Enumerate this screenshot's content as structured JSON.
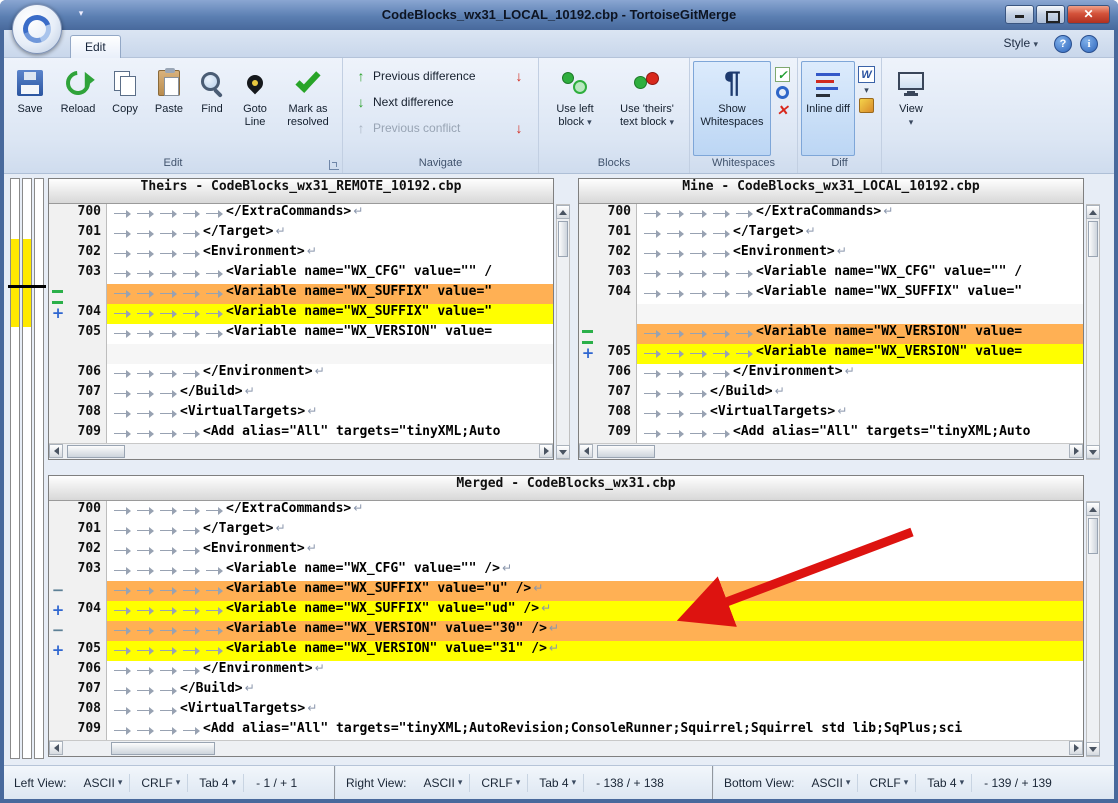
{
  "titlebar": {
    "title": "CodeBlocks_wx31_LOCAL_10192.cbp - TortoiseGitMerge"
  },
  "ribbon": {
    "tab_edit": "Edit",
    "style": "Style",
    "edit": {
      "label": "Edit",
      "save": "Save",
      "reload": "Reload",
      "copy": "Copy",
      "paste": "Paste",
      "find": "Find",
      "goto_line": "Goto Line",
      "mark_resolved": "Mark as resolved"
    },
    "navigate": {
      "label": "Navigate",
      "prev_diff": "Previous difference",
      "next_diff": "Next difference",
      "prev_conflict": "Previous conflict"
    },
    "blocks": {
      "label": "Blocks",
      "use_left": "Use left block",
      "use_theirs": "Use 'theirs' text block"
    },
    "whitespaces": {
      "label": "Whitespaces",
      "show_whitespaces": "Show Whitespaces"
    },
    "diff": {
      "label": "Diff",
      "inline_diff": "Inline diff"
    },
    "view": {
      "label": "View"
    }
  },
  "panes": [
    {
      "title": "Theirs - CodeBlocks_wx31_REMOTE_10192.cbp",
      "lines": [
        {
          "num": "700",
          "tabs": 5,
          "text": "</ExtraCommands>",
          "eol": true
        },
        {
          "num": "701",
          "tabs": 4,
          "text": "</Target>",
          "eol": true
        },
        {
          "num": "702",
          "tabs": 4,
          "text": "<Environment>",
          "eol": true
        },
        {
          "num": "703",
          "tabs": 5,
          "text": "<Variable name=\"WX_CFG\" value=\"\" /",
          "eol": false
        },
        {
          "num": "",
          "tabs": 5,
          "text": "<Variable name=\"WX_SUFFIX\" value=\"",
          "eol": false,
          "hl": "orange",
          "mark": "equal"
        },
        {
          "num": "704",
          "tabs": 5,
          "text": "<Variable name=\"WX_SUFFIX\" value=\"",
          "eol": false,
          "hl": "yellow",
          "mark": "add"
        },
        {
          "num": "705",
          "tabs": 5,
          "text": "<Variable name=\"WX_VERSION\" value=",
          "eol": false
        },
        {
          "num": "",
          "tabs": 0,
          "text": "",
          "filler": true
        },
        {
          "num": "706",
          "tabs": 4,
          "text": "</Environment>",
          "eol": true
        },
        {
          "num": "707",
          "tabs": 3,
          "text": "</Build>",
          "eol": true
        },
        {
          "num": "708",
          "tabs": 3,
          "text": "<VirtualTargets>",
          "eol": true
        },
        {
          "num": "709",
          "tabs": 4,
          "text": "<Add alias=\"All\" targets=\"tinyXML;Auto",
          "eol": false
        }
      ]
    },
    {
      "title": "Mine - CodeBlocks_wx31_LOCAL_10192.cbp",
      "lines": [
        {
          "num": "700",
          "tabs": 5,
          "text": "</ExtraCommands>",
          "eol": true
        },
        {
          "num": "701",
          "tabs": 4,
          "text": "</Target>",
          "eol": true
        },
        {
          "num": "702",
          "tabs": 4,
          "text": "<Environment>",
          "eol": true
        },
        {
          "num": "703",
          "tabs": 5,
          "text": "<Variable name=\"WX_CFG\" value=\"\" /",
          "eol": false
        },
        {
          "num": "704",
          "tabs": 5,
          "text": "<Variable name=\"WX_SUFFIX\" value=\"",
          "eol": false
        },
        {
          "num": "",
          "tabs": 0,
          "text": "",
          "filler": true
        },
        {
          "num": "",
          "tabs": 5,
          "text": "<Variable name=\"WX_VERSION\" value=",
          "eol": false,
          "hl": "orange",
          "mark": "equal"
        },
        {
          "num": "705",
          "tabs": 5,
          "text": "<Variable name=\"WX_VERSION\" value=",
          "eol": false,
          "hl": "yellow",
          "mark": "add"
        },
        {
          "num": "706",
          "tabs": 4,
          "text": "</Environment>",
          "eol": true
        },
        {
          "num": "707",
          "tabs": 3,
          "text": "</Build>",
          "eol": true
        },
        {
          "num": "708",
          "tabs": 3,
          "text": "<VirtualTargets>",
          "eol": true
        },
        {
          "num": "709",
          "tabs": 4,
          "text": "<Add alias=\"All\" targets=\"tinyXML;Auto",
          "eol": false
        }
      ]
    },
    {
      "title": "Merged - CodeBlocks_wx31.cbp",
      "lines": [
        {
          "num": "700",
          "tabs": 5,
          "text": "</ExtraCommands>",
          "eol": true
        },
        {
          "num": "701",
          "tabs": 4,
          "text": "</Target>",
          "eol": true
        },
        {
          "num": "702",
          "tabs": 4,
          "text": "<Environment>",
          "eol": true
        },
        {
          "num": "703",
          "tabs": 5,
          "text": "<Variable name=\"WX_CFG\" value=\"\" />",
          "eol": true
        },
        {
          "num": "",
          "tabs": 5,
          "text": "<Variable name=\"WX_SUFFIX\" value=\"u\" />",
          "eol": true,
          "hl": "orange",
          "mark": "del"
        },
        {
          "num": "704",
          "tabs": 5,
          "text": "<Variable name=\"WX_SUFFIX\" value=\"ud\" />",
          "eol": true,
          "hl": "yellow",
          "mark": "add"
        },
        {
          "num": "",
          "tabs": 5,
          "text": "<Variable name=\"WX_VERSION\" value=\"30\" />",
          "eol": true,
          "hl": "orange",
          "mark": "del"
        },
        {
          "num": "705",
          "tabs": 5,
          "text": "<Variable name=\"WX_VERSION\" value=\"31\" />",
          "eol": true,
          "hl": "yellow",
          "mark": "add"
        },
        {
          "num": "706",
          "tabs": 4,
          "text": "</Environment>",
          "eol": true
        },
        {
          "num": "707",
          "tabs": 3,
          "text": "</Build>",
          "eol": true
        },
        {
          "num": "708",
          "tabs": 3,
          "text": "<VirtualTargets>",
          "eol": true
        },
        {
          "num": "709",
          "tabs": 4,
          "text": "<Add alias=\"All\" targets=\"tinyXML;AutoRevision;ConsoleRunner;Squirrel;Squirrel std lib;SqPlus;sci",
          "eol": false
        }
      ]
    }
  ],
  "statusbar": {
    "left": {
      "label": "Left View:",
      "encoding": "ASCII",
      "eol": "CRLF",
      "tab": "Tab 4",
      "stats": "- 1 / + 1"
    },
    "right": {
      "label": "Right View:",
      "encoding": "ASCII",
      "eol": "CRLF",
      "tab": "Tab 4",
      "stats": "- 138 / + 138"
    },
    "bottom": {
      "label": "Bottom View:",
      "encoding": "ASCII",
      "eol": "CRLF",
      "tab": "Tab 4",
      "stats": "- 139 / + 139"
    }
  }
}
